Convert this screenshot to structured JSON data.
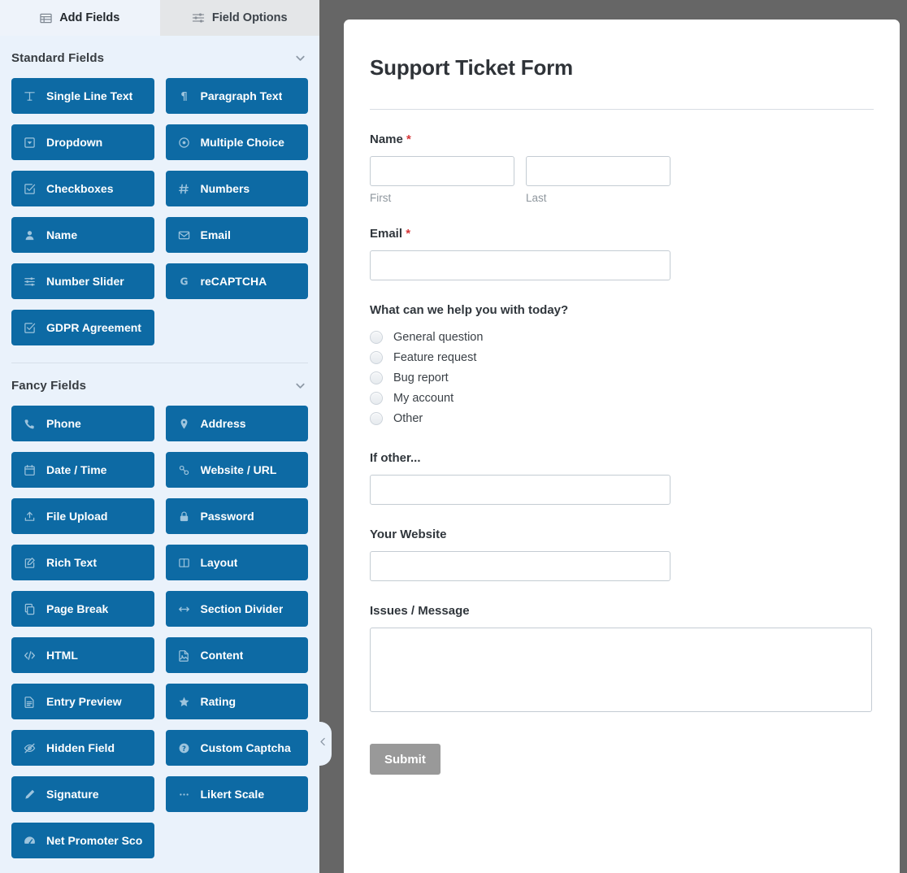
{
  "sidebar": {
    "tabs": [
      {
        "label": "Add Fields",
        "icon": "table-icon",
        "active": true
      },
      {
        "label": "Field Options",
        "icon": "sliders-icon",
        "active": false
      }
    ],
    "groups": [
      {
        "title": "Standard Fields",
        "chevron": "chevron-down-icon",
        "fields": [
          {
            "label": "Single Line Text",
            "icon": "text-width-icon"
          },
          {
            "label": "Paragraph Text",
            "icon": "paragraph-icon"
          },
          {
            "label": "Dropdown",
            "icon": "caret-square-down-icon"
          },
          {
            "label": "Multiple Choice",
            "icon": "radio-circle-icon"
          },
          {
            "label": "Checkboxes",
            "icon": "check-square-icon"
          },
          {
            "label": "Numbers",
            "icon": "hashtag-icon"
          },
          {
            "label": "Name",
            "icon": "user-icon"
          },
          {
            "label": "Email",
            "icon": "envelope-icon"
          },
          {
            "label": "Number Slider",
            "icon": "sliders-icon"
          },
          {
            "label": "reCAPTCHA",
            "icon": "google-g-icon"
          },
          {
            "label": "GDPR Agreement",
            "icon": "check-square-icon"
          }
        ]
      },
      {
        "title": "Fancy Fields",
        "chevron": "chevron-down-icon",
        "fields": [
          {
            "label": "Phone",
            "icon": "phone-icon"
          },
          {
            "label": "Address",
            "icon": "map-marker-icon"
          },
          {
            "label": "Date / Time",
            "icon": "calendar-icon"
          },
          {
            "label": "Website / URL",
            "icon": "link-icon"
          },
          {
            "label": "File Upload",
            "icon": "upload-icon"
          },
          {
            "label": "Password",
            "icon": "lock-icon"
          },
          {
            "label": "Rich Text",
            "icon": "pen-square-icon"
          },
          {
            "label": "Layout",
            "icon": "columns-icon"
          },
          {
            "label": "Page Break",
            "icon": "files-icon"
          },
          {
            "label": "Section Divider",
            "icon": "arrows-h-icon"
          },
          {
            "label": "HTML",
            "icon": "code-icon"
          },
          {
            "label": "Content",
            "icon": "file-image-icon"
          },
          {
            "label": "Entry Preview",
            "icon": "file-text-icon"
          },
          {
            "label": "Rating",
            "icon": "star-icon"
          },
          {
            "label": "Hidden Field",
            "icon": "eye-slash-icon"
          },
          {
            "label": "Custom Captcha",
            "icon": "question-circle-icon"
          },
          {
            "label": "Signature",
            "icon": "pencil-icon"
          },
          {
            "label": "Likert Scale",
            "icon": "ellipsis-icon"
          },
          {
            "label": "Net Promoter Score",
            "icon": "tachometer-icon"
          }
        ]
      }
    ],
    "collapse_handle_icon": "chevron-left-icon"
  },
  "preview": {
    "form_title": "Support Ticket Form",
    "required_marker": "*",
    "fields": {
      "name": {
        "label": "Name",
        "required": true,
        "first_sublabel": "First",
        "last_sublabel": "Last",
        "first_value": "",
        "last_value": ""
      },
      "email": {
        "label": "Email",
        "required": true,
        "value": ""
      },
      "help_topic": {
        "label": "What can we help you with today?",
        "required": false,
        "options": [
          "General question",
          "Feature request",
          "Bug report",
          "My account",
          "Other"
        ]
      },
      "if_other": {
        "label": "If other...",
        "required": false,
        "value": ""
      },
      "website": {
        "label": "Your Website",
        "required": false,
        "value": ""
      },
      "message": {
        "label": "Issues / Message",
        "required": false,
        "value": ""
      }
    },
    "submit_label": "Submit"
  },
  "colors": {
    "field_button_blue": "#0d6aa4",
    "sidebar_bg": "#eaf2fb",
    "backdrop_gray": "#666666",
    "required_red": "#d63638",
    "submit_gray": "#999999",
    "active_tab_bg": "#eef3fa",
    "inactive_tab_bg": "#e4e6e8"
  }
}
